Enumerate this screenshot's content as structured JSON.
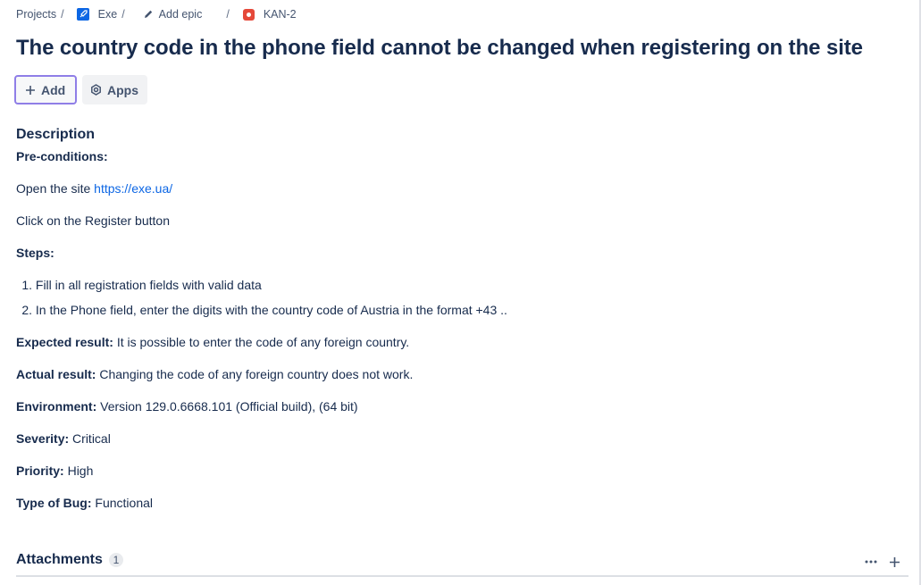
{
  "breadcrumb": {
    "projects": "Projects",
    "separator": "/",
    "project": "Exe",
    "add_epic": "Add epic",
    "issue_key": "KAN-2"
  },
  "issue": {
    "title": "The country code in the phone field cannot be changed when registering on the site"
  },
  "actions": {
    "add_label": "Add",
    "apps_label": "Apps"
  },
  "description": {
    "heading": "Description",
    "preconditions_label": "Pre-conditions:",
    "open_site_text": "Open the site",
    "site_link": "https://exe.ua/",
    "click_register": "Click on the Register button",
    "steps_label": "Steps:",
    "steps": [
      {
        "num": "1.",
        "text": "Fill in all registration fields with valid data"
      },
      {
        "num": "2.",
        "text": "In the Phone field, enter the digits with the country code of Austria in the format +43 .."
      }
    ],
    "expected_label": "Expected result:",
    "expected_value": "It is possible to enter the code of any foreign country.",
    "actual_label": "Actual result:",
    "actual_value": "Changing the code of any foreign country does not work.",
    "environment_label": "Environment:",
    "environment_value": "Version 129.0.6668.101 (Official build), (64 bit)",
    "severity_label": "Severity:",
    "severity_value": "Critical",
    "priority_label": "Priority:",
    "priority_value": "High",
    "bug_type_label": "Type of Bug:",
    "bug_type_value": "Functional"
  },
  "attachments": {
    "heading": "Attachments",
    "count": "1"
  },
  "icons": {
    "project": "rocket-icon",
    "epic": "pencil-icon",
    "issue_type": "bug-icon",
    "add": "plus-icon",
    "apps": "apps-icon",
    "more": "more-icon",
    "add_attachment": "plus-icon"
  },
  "colors": {
    "link": "#0c66e4",
    "text": "#172b4d",
    "bug": "#e5493a",
    "focus_border": "#8f7ee7"
  }
}
